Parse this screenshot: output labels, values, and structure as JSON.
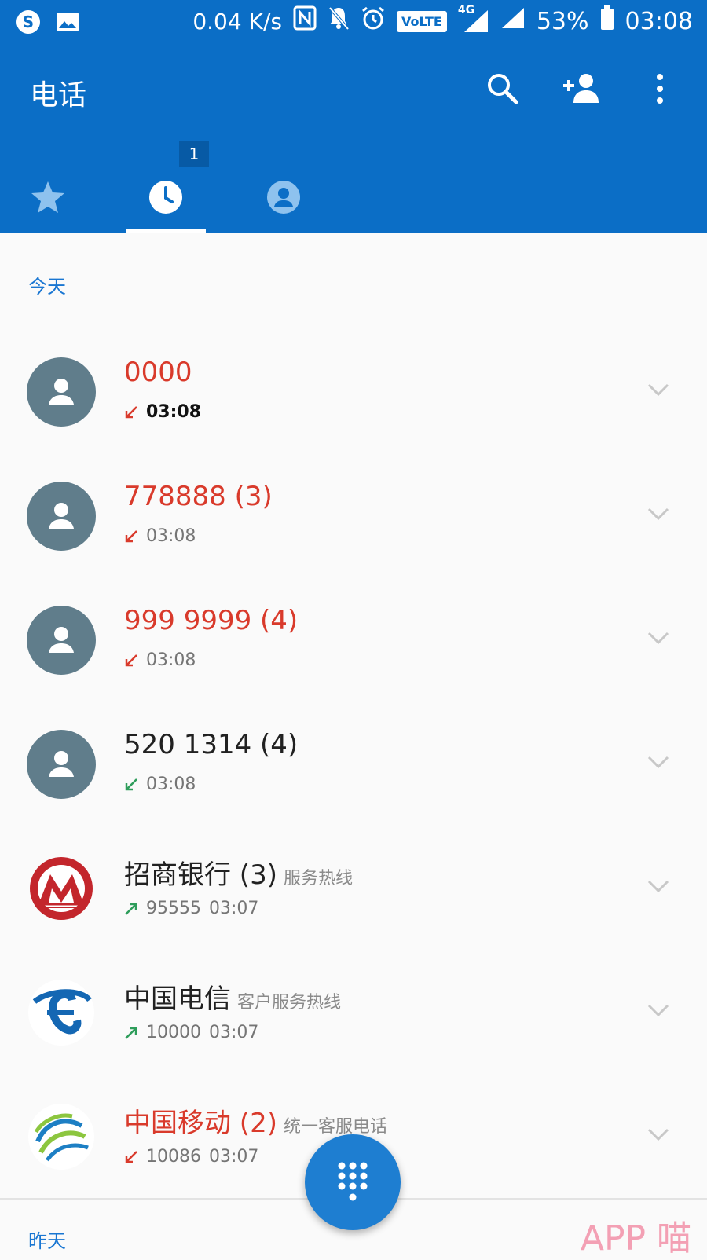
{
  "status_bar": {
    "speed": "0.04 K/s",
    "volte": "VoLTE",
    "network": "4G",
    "battery": "53%",
    "time": "03:08"
  },
  "app_bar": {
    "title": "电话",
    "actions": [
      "search-icon",
      "add-contact-icon",
      "more-icon"
    ]
  },
  "tabs": {
    "items": [
      "favorites-star-icon",
      "recents-clock-icon",
      "contacts-icon"
    ],
    "active": 1,
    "badge": "1"
  },
  "sections": {
    "today": "今天",
    "yesterday": "昨天"
  },
  "calls": [
    {
      "name": "0000",
      "name_color": "#d93a2b",
      "type": "missed",
      "number": "",
      "time": "03:08",
      "desc": "",
      "bold": true,
      "avatar": "person"
    },
    {
      "name": "778888 (3)",
      "name_color": "#d93a2b",
      "type": "missed",
      "number": "",
      "time": "03:08",
      "desc": "",
      "bold": false,
      "avatar": "person"
    },
    {
      "name": "999 9999 (4)",
      "name_color": "#d93a2b",
      "type": "missed",
      "number": "",
      "time": "03:08",
      "desc": "",
      "bold": false,
      "avatar": "person"
    },
    {
      "name": "520 1314 (4)",
      "name_color": "#212121",
      "type": "incoming",
      "number": "",
      "time": "03:08",
      "desc": "",
      "bold": false,
      "avatar": "person"
    },
    {
      "name": "招商银行 (3)",
      "name_color": "#212121",
      "type": "outgoing",
      "number": "95555",
      "time": "03:07",
      "desc": "服务热线",
      "bold": false,
      "avatar": "cmb-logo"
    },
    {
      "name": "中国电信",
      "name_color": "#212121",
      "type": "outgoing",
      "number": "10000",
      "time": "03:07",
      "desc": "客户服务热线",
      "bold": false,
      "avatar": "telecom-logo"
    },
    {
      "name": "中国移动 (2)",
      "name_color": "#d93a2b",
      "type": "missed",
      "number": "10086",
      "time": "03:07",
      "desc": "统一客服电话",
      "bold": false,
      "avatar": "mobile-logo"
    }
  ],
  "fab": "dialpad-icon",
  "watermark": "APP 喵",
  "colors": {
    "primary": "#0b6ec6",
    "accent": "#1e7ed1",
    "missed": "#d93a2b",
    "received": "#2e9d5b"
  }
}
